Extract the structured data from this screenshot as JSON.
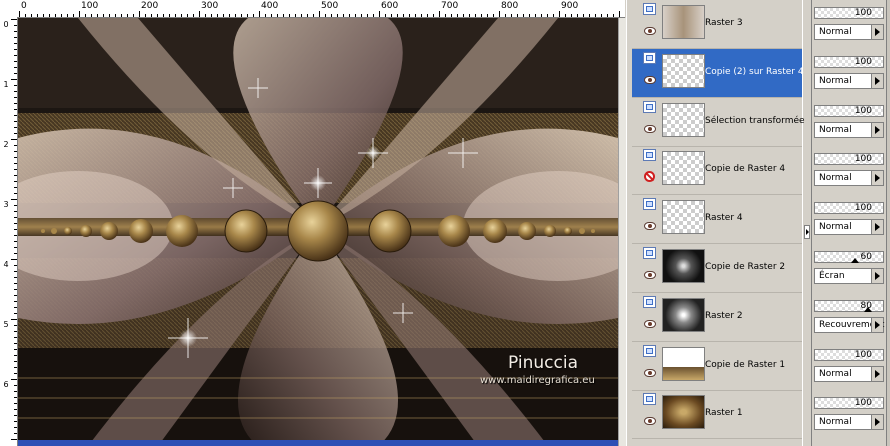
{
  "ruler": {
    "top_labels": [
      "0",
      "100",
      "200",
      "300",
      "400",
      "500",
      "600",
      "700",
      "800",
      "900"
    ],
    "left_labels": [
      "0",
      "1",
      "2",
      "3",
      "4",
      "5",
      "6"
    ]
  },
  "canvas": {
    "watermark_title": "Pinuccia",
    "watermark_url": "www.maidiregrafica.eu"
  },
  "layers": [
    {
      "name": "Raster 3",
      "visible": true,
      "selected": false,
      "opacity": "100",
      "blend": "Normal"
    },
    {
      "name": "Copie (2) sur Raster 4",
      "visible": true,
      "selected": true,
      "opacity": "100",
      "blend": "Normal"
    },
    {
      "name": "Sélection transformée",
      "visible": true,
      "selected": false,
      "opacity": "100",
      "blend": "Normal"
    },
    {
      "name": "Copie de Raster 4",
      "visible": false,
      "selected": false,
      "opacity": "100",
      "blend": "Normal"
    },
    {
      "name": "Raster 4",
      "visible": true,
      "selected": false,
      "opacity": "100",
      "blend": "Normal"
    },
    {
      "name": "Copie de Raster 2",
      "visible": true,
      "selected": false,
      "opacity": "60",
      "blend": "Écran"
    },
    {
      "name": "Raster 2",
      "visible": true,
      "selected": false,
      "opacity": "80",
      "blend": "Recouvrement"
    },
    {
      "name": "Copie de Raster 1",
      "visible": true,
      "selected": false,
      "opacity": "100",
      "blend": "Normal"
    },
    {
      "name": "Raster 1",
      "visible": true,
      "selected": false,
      "opacity": "100",
      "blend": "Normal"
    }
  ],
  "colors": {
    "selection": "#316ac5",
    "panel_bg": "#d4d0c8",
    "canvas_dark": "#1b1410",
    "gold": "#a8874a",
    "mauve": "#8a7270"
  }
}
